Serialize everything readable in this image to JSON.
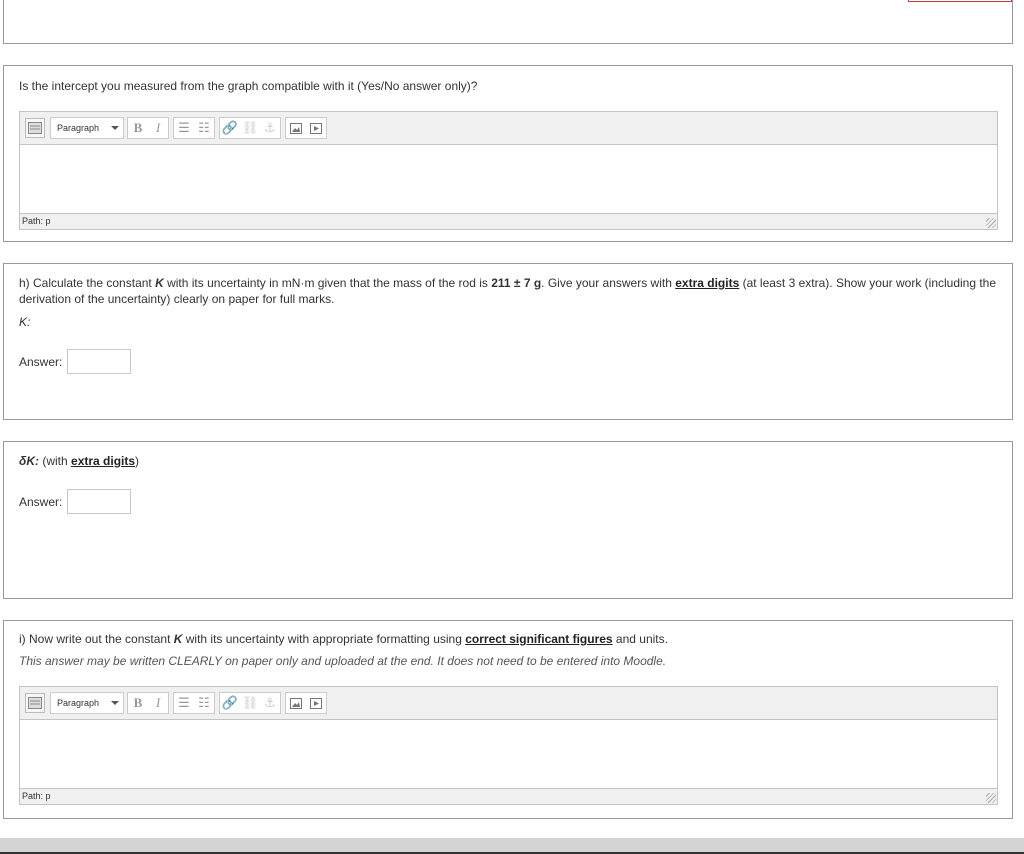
{
  "q_g": {
    "text": "Is the intercept you measured from the graph compatible with it (Yes/No answer only)?",
    "editor": {
      "format": "Paragraph",
      "path_label": "Path: p"
    }
  },
  "q_h": {
    "prefix": "h) Calculate the constant ",
    "var": "K",
    "mid": " with its uncertainty in mN·m given that the mass of the rod is ",
    "mass": "211 ± 7 g",
    "mid2": ". Give your answers with ",
    "link": "extra digits",
    "suffix": " (at least 3 extra). Show your work (including the derivation of the uncertainty) clearly on paper for full marks.",
    "sub_label": "K:",
    "answer_label": "Answer:"
  },
  "q_dk": {
    "var": "δK:",
    "prefix": " (with ",
    "link": "extra digits",
    "suffix": ")",
    "answer_label": "Answer:"
  },
  "q_i": {
    "prefix": "i) Now write out the constant ",
    "var": "K",
    "mid": " with its uncertainty with appropriate formatting using ",
    "link": "correct significant figures",
    "suffix": " and units.",
    "note": "This answer may be written CLEARLY on paper only and uploaded at the end. It does not need to be entered into Moodle.",
    "editor": {
      "format": "Paragraph",
      "path_label": "Path: p"
    }
  },
  "toolbar": {
    "bold": "B",
    "italic": "I"
  }
}
